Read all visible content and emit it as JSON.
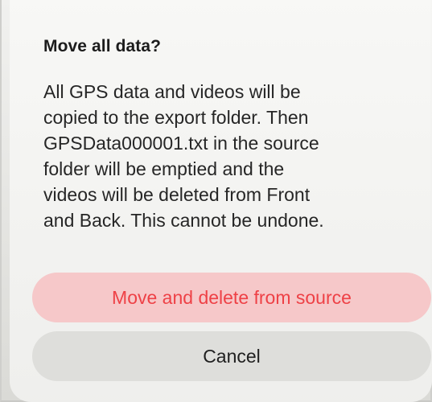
{
  "dialog": {
    "title": "Move all data?",
    "message_lines": [
      "All GPS data and videos will be",
      "copied to the export folder. Then",
      "GPSData000001.txt in the source",
      "folder will be emptied and the",
      "videos will be deleted from Front",
      "and Back. This cannot be undone."
    ],
    "buttons": {
      "destructive_label": "Move and delete from source",
      "cancel_label": "Cancel"
    }
  },
  "colors": {
    "destructive_text": "#ee4146",
    "destructive_bg": "#f6c8c9",
    "cancel_bg": "#dededb"
  }
}
